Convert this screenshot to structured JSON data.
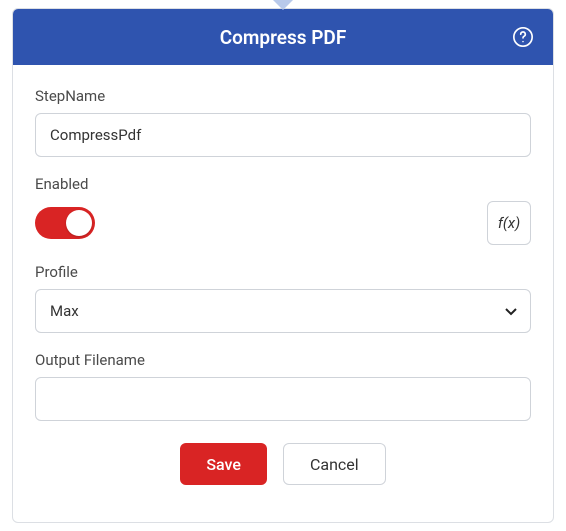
{
  "header": {
    "title": "Compress PDF"
  },
  "fields": {
    "stepName": {
      "label": "StepName",
      "value": "CompressPdf"
    },
    "enabled": {
      "label": "Enabled",
      "on": true,
      "fx_label": "f(x)"
    },
    "profile": {
      "label": "Profile",
      "value": "Max"
    },
    "outputFilename": {
      "label": "Output Filename",
      "value": ""
    }
  },
  "buttons": {
    "save": "Save",
    "cancel": "Cancel"
  }
}
